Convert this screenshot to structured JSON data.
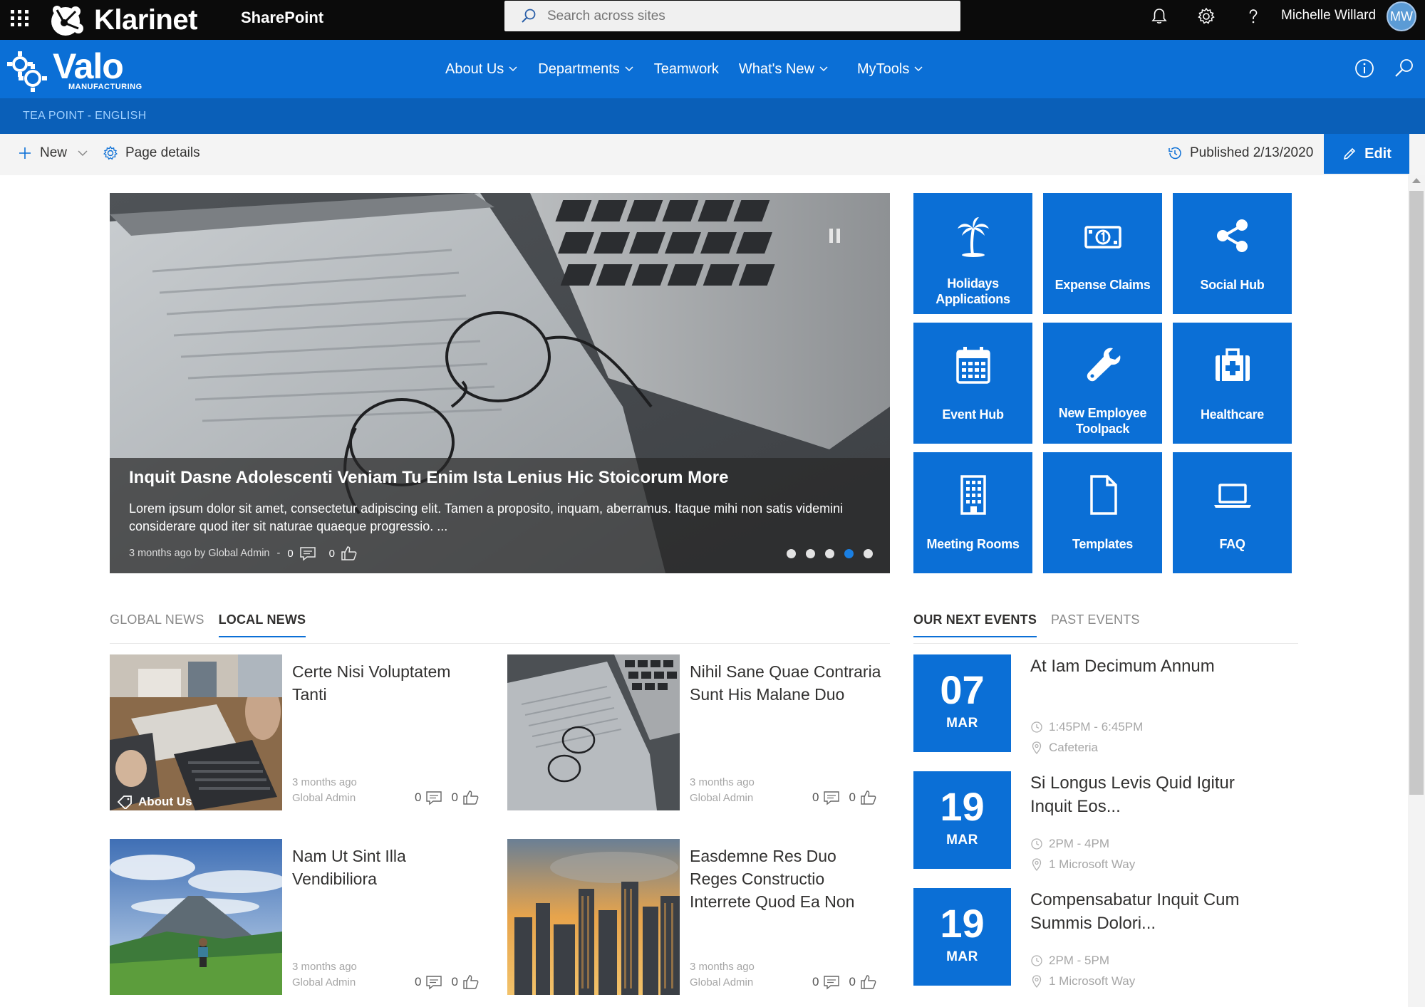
{
  "suitebar": {
    "brand": "Klarinet",
    "app": "SharePoint",
    "search_placeholder": "Search across sites",
    "user_name": "Michelle Willard",
    "user_initials": "MW"
  },
  "site": {
    "logo_name": "Valo",
    "logo_sub": "MANUFACTURING",
    "nav": [
      "About Us",
      "Departments",
      "Teamwork",
      "What's New",
      "MyTools"
    ],
    "breadcrumb": "TEA POINT - ENGLISH"
  },
  "commandbar": {
    "new_label": "New",
    "page_details_label": "Page details",
    "published": "Published 2/13/2020",
    "edit_label": "Edit"
  },
  "hero": {
    "title": "Inquit Dasne Adolescenti Veniam Tu Enim Ista Lenius Hic Stoicorum More",
    "description": "Lorem ipsum dolor sit amet, consectetur adipiscing elit. Tamen a proposito, inquam, aberramus. Itaque mihi non satis videmini considerare quod iter sit naturae quaeque progressio. ...",
    "meta": "3 months ago by Global Admin",
    "meta_sep": "-",
    "comments": "0",
    "likes": "0",
    "slide_count": 5,
    "active_slide": 4
  },
  "tiles": [
    {
      "label": "Holidays Applications",
      "icon": "palm-tree-icon"
    },
    {
      "label": "Expense Claims",
      "icon": "banknote-icon"
    },
    {
      "label": "Social Hub",
      "icon": "share-icon"
    },
    {
      "label": "Event Hub",
      "icon": "calendar-icon"
    },
    {
      "label": "New Employee Toolpack",
      "icon": "wrench-icon"
    },
    {
      "label": "Healthcare",
      "icon": "medical-kit-icon"
    },
    {
      "label": "Meeting Rooms",
      "icon": "building-icon"
    },
    {
      "label": "Templates",
      "icon": "document-icon"
    },
    {
      "label": "FAQ",
      "icon": "laptop-icon"
    }
  ],
  "news": {
    "tabs": [
      "GLOBAL NEWS",
      "LOCAL NEWS"
    ],
    "active_tab": "LOCAL NEWS",
    "items": [
      {
        "title": "Certe Nisi Voluptatem Tanti",
        "time": "3 months ago",
        "author": "Global Admin",
        "comments": "0",
        "likes": "0",
        "tag": "About Us"
      },
      {
        "title": "Nihil Sane Quae Contraria Sunt His Malane Duo",
        "time": "3 months ago",
        "author": "Global Admin",
        "comments": "0",
        "likes": "0"
      },
      {
        "title": "Nam Ut Sint Illa Vendibiliora",
        "time": "3 months ago",
        "author": "Global Admin",
        "comments": "0",
        "likes": "0"
      },
      {
        "title": "Easdemne Res Duo Reges Constructio Interrete Quod Ea Non",
        "time": "3 months ago",
        "author": "Global Admin",
        "comments": "0",
        "likes": "0"
      }
    ]
  },
  "events": {
    "tabs": [
      "OUR NEXT EVENTS",
      "PAST EVENTS"
    ],
    "active_tab": "OUR NEXT EVENTS",
    "items": [
      {
        "day": "07",
        "month": "MAR",
        "title": "At Iam Decimum Annum",
        "time": "1:45PM - 6:45PM",
        "location": "Cafeteria"
      },
      {
        "day": "19",
        "month": "MAR",
        "title": "Si Longus Levis Quid Igitur Inquit Eos...",
        "time": "2PM - 4PM",
        "location": "1 Microsoft Way"
      },
      {
        "day": "19",
        "month": "MAR",
        "title": "Compensabatur Inquit Cum Summis Dolori...",
        "time": "2PM - 5PM",
        "location": "1 Microsoft Way"
      }
    ]
  },
  "colors": {
    "suitebar": "#0b0b0b",
    "brand_blue": "#0b6fd6",
    "breadcrumb_bar": "#0a5fb8",
    "commandbar": "#f4f4f4"
  }
}
